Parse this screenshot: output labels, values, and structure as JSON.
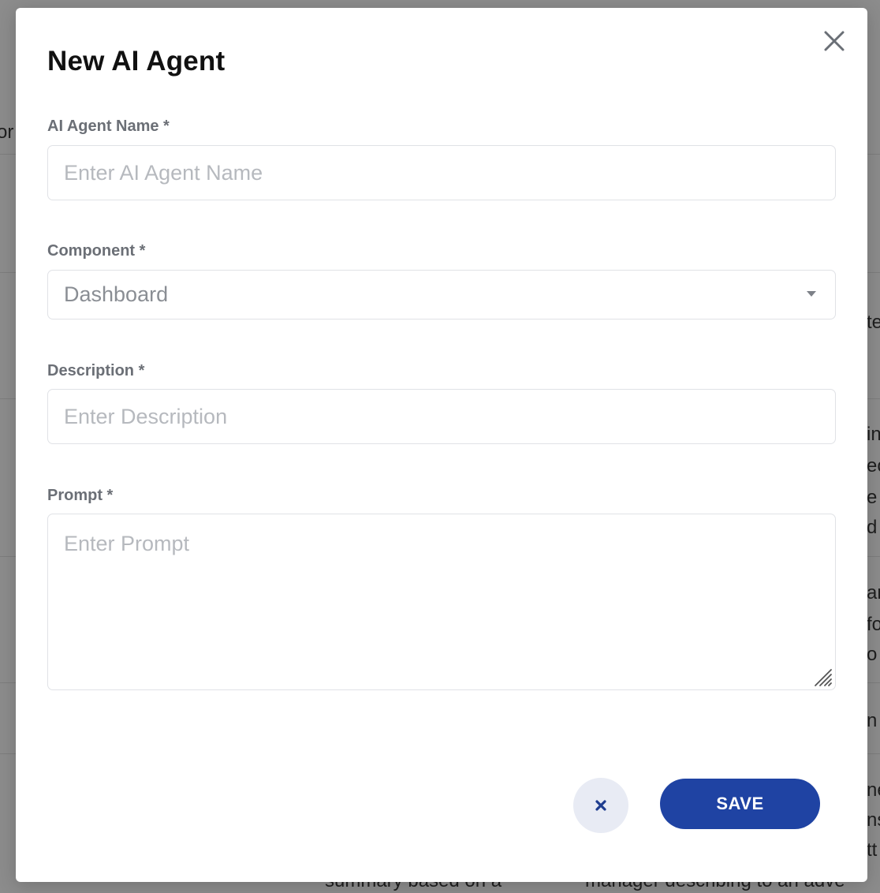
{
  "modal": {
    "title": "New AI Agent",
    "close_icon": "close-icon",
    "fields": {
      "agent_name": {
        "label": "AI Agent Name *",
        "placeholder": "Enter AI Agent Name",
        "value": ""
      },
      "component": {
        "label": "Component *",
        "selected": "Dashboard"
      },
      "description": {
        "label": "Description *",
        "placeholder": "Enter Description",
        "value": ""
      },
      "prompt": {
        "label": "Prompt *",
        "placeholder": "Enter Prompt",
        "value": ""
      }
    },
    "actions": {
      "cancel_icon": "close-icon",
      "save_label": "SAVE"
    }
  },
  "background": {
    "fragments": [
      "or",
      "te",
      "in",
      "ec",
      "e",
      "d",
      "ar",
      "fo",
      "o",
      "n E",
      "ne",
      "ns",
      "tt",
      "summary based on a",
      "manager describing to an adve"
    ]
  },
  "colors": {
    "accent": "#1f43a3",
    "cancel_bg": "#e8ebf4",
    "label": "#6b6f76",
    "border": "#e0e2e6",
    "placeholder": "#b6b9be"
  }
}
